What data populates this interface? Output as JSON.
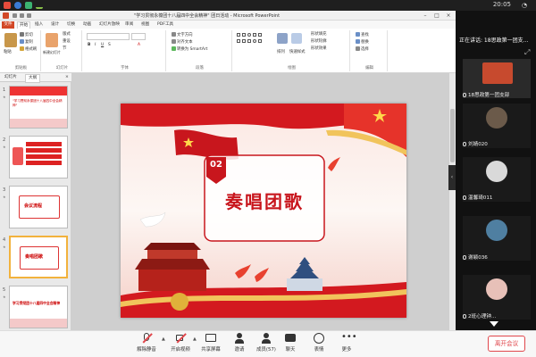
{
  "os": {
    "time": "20:05"
  },
  "window": {
    "title": "\"学习贯彻永葆团十八届四中全会精神\" 团日活动 - Microsoft PowerPoint"
  },
  "ribbon_tabs": [
    "文件",
    "开始",
    "插入",
    "设计",
    "切换",
    "动画",
    "幻灯片放映",
    "审阅",
    "视图",
    "PDF工具"
  ],
  "ribbon": {
    "clipboard": {
      "paste": "粘贴",
      "cut": "剪切",
      "copy": "复制",
      "painter": "格式刷",
      "group": "剪贴板"
    },
    "slides": {
      "new_slide": "新建幻灯片",
      "layout": "版式",
      "reset": "重设",
      "section": "节",
      "group": "幻灯片"
    },
    "font": {
      "group": "字体"
    },
    "paragraph": {
      "text_dir": "文字方向",
      "align": "对齐文本",
      "smartart": "转换为 SmartArt",
      "group": "段落"
    },
    "drawing": {
      "arrange": "排列",
      "quick_styles": "快速样式",
      "fill": "形状填充",
      "outline": "形状轮廓",
      "effect": "形状效果",
      "group": "绘图"
    },
    "editing": {
      "find": "查找",
      "replace": "替换",
      "select": "选择",
      "group": "编辑"
    }
  },
  "panel": {
    "tabs": [
      "幻灯片",
      "大纲"
    ],
    "slides": [
      {
        "num": "1",
        "text": "\"学习贯彻永葆团十八届四中全会精神\""
      },
      {
        "num": "2",
        "text": ""
      },
      {
        "num": "3",
        "text": "会议流程"
      },
      {
        "num": "4",
        "text": "奏唱团歌"
      },
      {
        "num": "5",
        "text": "学习贯彻团十八届四中全会精神"
      }
    ]
  },
  "slide": {
    "number": "02",
    "title": "奏唱团歌"
  },
  "side": {
    "speaking": "正在讲话: 18思政第一团支...",
    "participants": [
      {
        "name": "18思政第一团支部"
      },
      {
        "name": "刘婧020"
      },
      {
        "name": "温馨琦011"
      },
      {
        "name": "谢颖036"
      },
      {
        "name": "2班心理钟..."
      }
    ]
  },
  "toolbar": {
    "mute": "解除静音",
    "video": "开启视频",
    "share": "共享屏幕",
    "invite": "邀请",
    "members": "成员(57)",
    "chat": "聊天",
    "reaction": "表情",
    "more": "更多",
    "leave": "离开会议"
  },
  "colors": {
    "ppt_accent": "#d24726",
    "slide_red": "#c8161d",
    "leave_red": "#e0474c"
  }
}
